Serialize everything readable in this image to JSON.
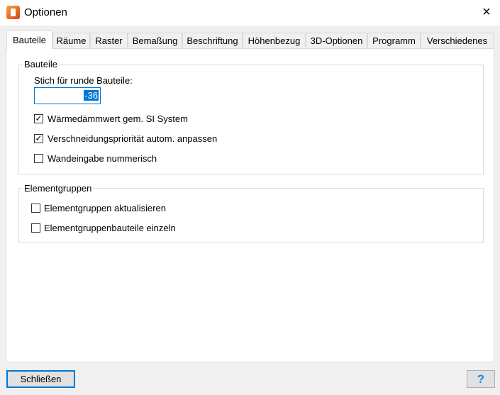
{
  "window": {
    "title": "Optionen",
    "close_icon": "×"
  },
  "tabs": [
    "Bauteile",
    "Räume",
    "Raster",
    "Bemaßung",
    "Beschriftung",
    "Höhenbezug",
    "3D-Optionen",
    "Programm",
    "Verschiedenes"
  ],
  "group_bauteile": {
    "legend": "Bauteile",
    "stich_label": "Stich für runde Bauteile:",
    "stich_value": "-36",
    "checkboxes": [
      {
        "label": "Wärmedämmwert gem. SI System",
        "checked": true
      },
      {
        "label": "Verschneidungspriorität autom. anpassen",
        "checked": true
      },
      {
        "label": "Wandeingabe nummerisch",
        "checked": false
      }
    ]
  },
  "group_elementgruppen": {
    "legend": "Elementgruppen",
    "checkboxes": [
      {
        "label": "Elementgruppen aktualisieren",
        "checked": false
      },
      {
        "label": "Elementgruppenbauteile einzeln",
        "checked": false
      }
    ]
  },
  "buttons": {
    "close": "Schließen",
    "help": "?"
  },
  "colors": {
    "accent": "#0078d7"
  }
}
